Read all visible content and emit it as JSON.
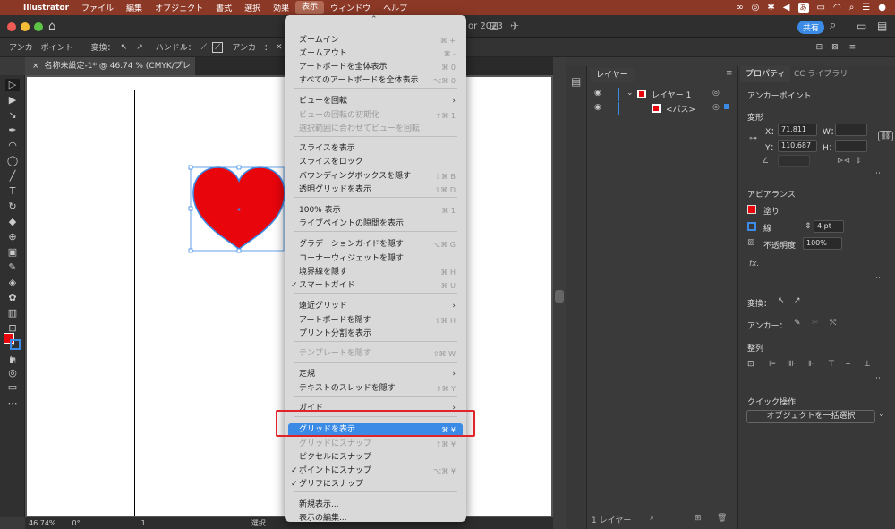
{
  "menubar": {
    "apple": "",
    "app": "Illustrator",
    "items": [
      "ファイル",
      "編集",
      "オブジェクト",
      "書式",
      "選択",
      "効果",
      "表示",
      "ウィンドウ",
      "ヘルプ"
    ],
    "date_icon": "あ"
  },
  "titlebar": {
    "title_fragment": "or 2023",
    "share": "共有"
  },
  "control": {
    "anchor": "アンカーポイント",
    "convert": "変換：",
    "handle": "ハンドル：",
    "anchor2": "アンカー："
  },
  "doc": {
    "tab": "名称未設定-1* @ 46.74 % (CMYK/プレビュー)"
  },
  "status": {
    "zoom": "46.74%",
    "angle": "0°",
    "page": "1",
    "mode": "選択"
  },
  "layers": {
    "tab": "レイヤー",
    "layer1": "レイヤー 1",
    "path": "<パス>",
    "count": "1 レイヤー"
  },
  "props": {
    "tab1": "プロパティ",
    "tab2": "CC ライブラリ",
    "anchor": "アンカーポイント",
    "transform": "変形",
    "x_label": "X：",
    "x": "71.811",
    "y_label": "Y：",
    "y": "110.687",
    "w_label": "W：",
    "h_label": "H：",
    "appearance": "アピアランス",
    "fill": "塗り",
    "stroke": "線",
    "stroke_w": "4 pt",
    "opacity_label": "不透明度",
    "opacity": "100%",
    "fx": "fx.",
    "convert": "変換：",
    "anchor2": "アンカー：",
    "align": "整列",
    "quick": "クイック操作",
    "quick_btn": "オブジェクトを一括選択"
  },
  "menu": {
    "items": [
      {
        "label": "ズームイン",
        "sc": "⌘ +"
      },
      {
        "label": "ズームアウト",
        "sc": "⌘ -"
      },
      {
        "label": "アートボードを全体表示",
        "sc": "⌘ 0"
      },
      {
        "label": "すべてのアートボードを全体表示",
        "sc": "⌥⌘ 0"
      },
      {
        "label": "ビューを回転",
        "sc": ""
      },
      {
        "label": "ビューの回転の初期化",
        "sc": "⇧⌘ 1"
      },
      {
        "label": "選択範囲に合わせてビューを回転",
        "sc": ""
      },
      {
        "label": "スライスを表示",
        "sc": ""
      },
      {
        "label": "スライスをロック",
        "sc": ""
      },
      {
        "label": "バウンディングボックスを隠す",
        "sc": "⇧⌘ B"
      },
      {
        "label": "透明グリッドを表示",
        "sc": "⇧⌘ D"
      },
      {
        "label": "100% 表示",
        "sc": "⌘ 1"
      },
      {
        "label": "ライブペイントの隙間を表示",
        "sc": ""
      },
      {
        "label": "グラデーションガイドを隠す",
        "sc": "⌥⌘ G"
      },
      {
        "label": "コーナーウィジェットを隠す",
        "sc": ""
      },
      {
        "label": "境界線を隠す",
        "sc": "⌘ H"
      },
      {
        "label": "スマートガイド",
        "sc": "⌘ U"
      },
      {
        "label": "遠近グリッド",
        "sc": ""
      },
      {
        "label": "アートボードを隠す",
        "sc": "⇧⌘ H"
      },
      {
        "label": "プリント分割を表示",
        "sc": ""
      },
      {
        "label": "テンプレートを隠す",
        "sc": "⇧⌘ W"
      },
      {
        "label": "定規",
        "sc": ""
      },
      {
        "label": "テキストのスレッドを隠す",
        "sc": "⇧⌘ Y"
      },
      {
        "label": "ガイド",
        "sc": ""
      },
      {
        "label": "グリッドを表示",
        "sc": "⌘ ¥"
      },
      {
        "label": "グリッドにスナップ",
        "sc": "⇧⌘ ¥"
      },
      {
        "label": "ピクセルにスナップ",
        "sc": ""
      },
      {
        "label": "ポイントにスナップ",
        "sc": "⌥⌘ ¥"
      },
      {
        "label": "グリフにスナップ",
        "sc": ""
      },
      {
        "label": "新規表示...",
        "sc": ""
      },
      {
        "label": "表示の編集...",
        "sc": ""
      }
    ]
  },
  "colors": {
    "menubar": "#8c3826",
    "accent": "#3b8be6",
    "heart": "#e8050c",
    "highlight_box": "#e0242a"
  }
}
